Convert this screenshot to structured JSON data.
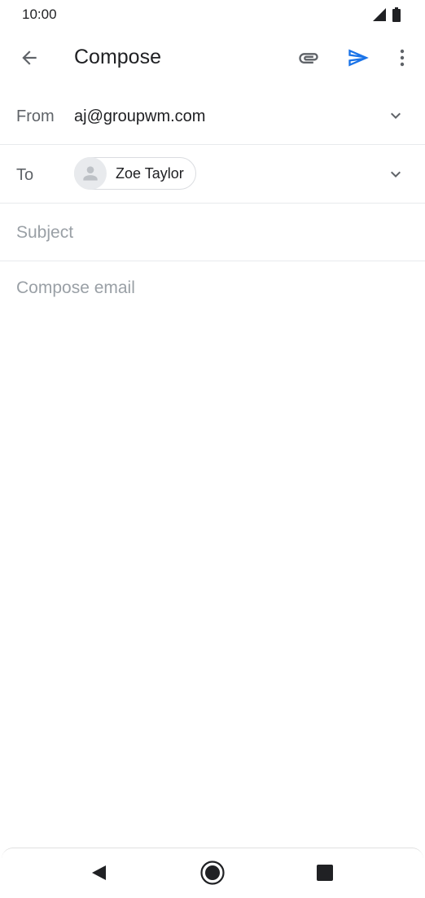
{
  "status_bar": {
    "time": "10:00",
    "signal_icon": "cell-signal-icon",
    "battery_icon": "battery-icon"
  },
  "app_bar": {
    "title": "Compose",
    "back_icon": "arrow-back-icon",
    "attach_icon": "paperclip-icon",
    "send_icon": "send-icon",
    "more_icon": "more-vert-icon"
  },
  "from": {
    "label": "From",
    "value": "aj@groupwm.com"
  },
  "to": {
    "label": "To",
    "recipients": [
      {
        "name": "Zoe Taylor"
      }
    ]
  },
  "subject": {
    "value": "",
    "placeholder": "Subject"
  },
  "body": {
    "value": "",
    "placeholder": "Compose email"
  },
  "nav_bar": {
    "back_icon": "nav-back-icon",
    "home_icon": "nav-home-icon",
    "recents_icon": "nav-recents-icon"
  },
  "colors": {
    "accent": "#1a73e8",
    "text_primary": "#202124",
    "text_secondary": "#5f6368",
    "placeholder": "#9aa0a6",
    "divider": "#e8eaed"
  }
}
